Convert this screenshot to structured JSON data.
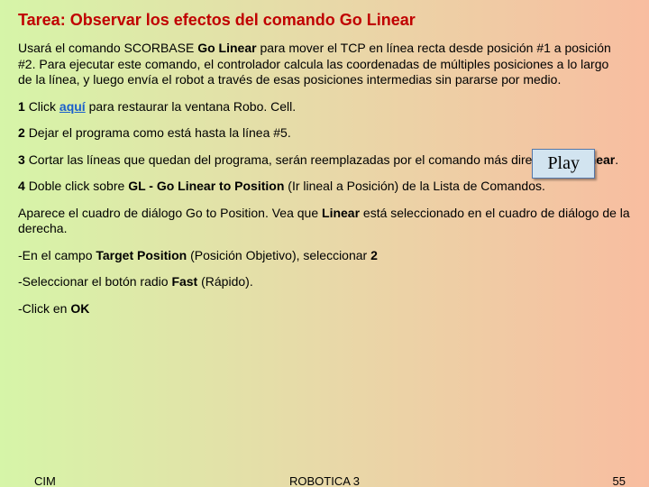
{
  "title": "Tarea: Observar los efectos del comando Go Linear",
  "intro": {
    "pre": "Usará el comando SCORBASE ",
    "bold1": "Go Linear",
    "post": " para mover el TCP en línea recta desde posición #1 a posición #2. Para ejecutar este comando, el controlador calcula las coordenadas de múltiples posiciones a lo largo de la línea, y luego envía el robot a través de esas posiciones intermedias sin pararse por medio."
  },
  "step1": {
    "num": "1 ",
    "pre": "Click ",
    "link": "aquí",
    "post": " para restaurar la ventana Robo. Cell."
  },
  "step2": {
    "num": "2 ",
    "text": "Dejar el programa como está hasta la línea #5."
  },
  "step3": {
    "num": "3 ",
    "pre": "Cortar las líneas que quedan del programa, serán reemplazadas por el comando más directo, ",
    "bold": "Go Linear",
    "post": "."
  },
  "step4": {
    "num": "4 ",
    "pre": "Doble click sobre ",
    "bold": "GL - Go Linear to Position",
    "post": " (Ir lineal a Posición) de la Lista de Comandos."
  },
  "note1": {
    "pre": "Aparece el cuadro de diálogo Go to Position. Vea que ",
    "bold": "Linear",
    "post": " está seleccionado en el cuadro de diálogo de la derecha."
  },
  "note2": {
    "pre": "-En el campo ",
    "bold": "Target Position",
    "mid": " (Posición Objetivo), seleccionar ",
    "bold2": "2"
  },
  "note3": {
    "pre": "-Seleccionar el botón radio ",
    "bold": "Fast",
    "post": " (Rápido)."
  },
  "note4": {
    "pre": "-Click en ",
    "bold": "OK"
  },
  "play_label": "Play",
  "footer": {
    "left": "CIM",
    "center": "ROBOTICA 3",
    "right": "55"
  }
}
